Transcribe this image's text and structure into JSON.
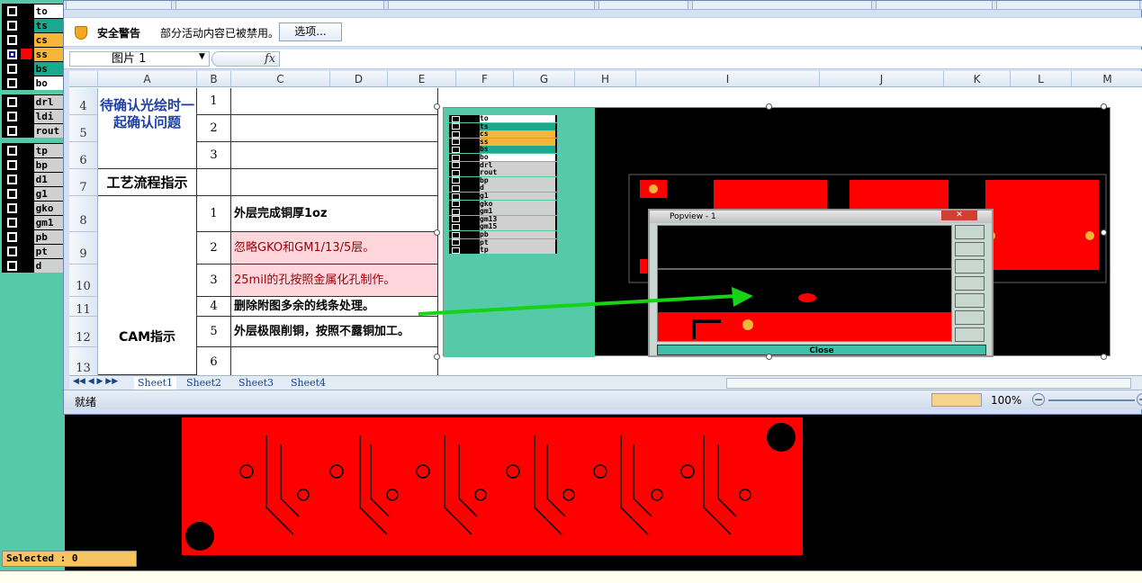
{
  "cam_layers_top": [
    {
      "name": "to",
      "color": "#ffffff",
      "swatch": "#000000"
    },
    {
      "name": "ts",
      "color": "#1ca88c",
      "swatch": "#000000"
    },
    {
      "name": "cs",
      "color": "#f5b63a",
      "swatch": "#000000"
    },
    {
      "name": "ss",
      "color": "#f5b63a",
      "swatch": "#ff0000",
      "selected": true
    },
    {
      "name": "bs",
      "color": "#1ca88c",
      "swatch": "#000000"
    },
    {
      "name": "bo",
      "color": "#ffffff",
      "swatch": "#000000"
    }
  ],
  "cam_layers_mid": [
    {
      "name": "drl",
      "color": "#d0d0d0"
    },
    {
      "name": "ldi",
      "color": "#d0d0d0"
    },
    {
      "name": "rout",
      "color": "#d0d0d0"
    }
  ],
  "cam_layers_bottom": [
    {
      "name": "tp",
      "color": "#d0d0d0"
    },
    {
      "name": "bp",
      "color": "#d0d0d0"
    },
    {
      "name": "d1",
      "color": "#d0d0d0"
    },
    {
      "name": "g1",
      "color": "#d0d0d0"
    },
    {
      "name": "gko",
      "color": "#d0d0d0"
    },
    {
      "name": "gm1",
      "color": "#d0d0d0"
    },
    {
      "name": "pb",
      "color": "#d0d0d0"
    },
    {
      "name": "pt",
      "color": "#d0d0d0"
    },
    {
      "name": "d",
      "color": "#d0d0d0"
    }
  ],
  "selected_label": "Selected : 0",
  "security": {
    "title": "安全警告",
    "message": "部分活动内容已被禁用。",
    "options_button": "选项..."
  },
  "name_box": "图片 1",
  "fx_label": "fx",
  "columns": [
    "A",
    "B",
    "C",
    "D",
    "E",
    "F",
    "G",
    "H",
    "I",
    "J",
    "K",
    "L",
    "M"
  ],
  "rows": [
    {
      "num": "4",
      "b": "1",
      "c": ""
    },
    {
      "num": "5",
      "b": "2",
      "c": ""
    },
    {
      "num": "6",
      "b": "3",
      "c": ""
    },
    {
      "num": "7",
      "b": "",
      "c": ""
    },
    {
      "num": "8",
      "b": "1",
      "c": "外层完成铜厚1oz"
    },
    {
      "num": "9",
      "b": "2",
      "c": "忽略GKO和GM1/13/5层。"
    },
    {
      "num": "10",
      "b": "3",
      "c": "25mil的孔按照金属化孔制作。"
    },
    {
      "num": "11",
      "b": "4",
      "c": "删除附图多余的线条处理。"
    },
    {
      "num": "12",
      "b": "5",
      "c": "外层极限削铜，按照不露铜加工。"
    },
    {
      "num": "13",
      "b": "6",
      "c": ""
    }
  ],
  "merged_a": {
    "confirm": "待确认光绘时一起确认问题",
    "process": "工艺流程指示",
    "cam": "CAM指示"
  },
  "sheets": [
    "Sheet1",
    "Sheet2",
    "Sheet3",
    "Sheet4"
  ],
  "status": {
    "ready": "就绪",
    "zoom": "100%"
  },
  "pic_layers": [
    {
      "name": "to",
      "color": "#ffffff"
    },
    {
      "name": "ts",
      "color": "#1ca88c"
    },
    {
      "name": "cs",
      "color": "#f5b63a"
    },
    {
      "name": "ss",
      "color": "#f5b63a"
    },
    {
      "name": "bs",
      "color": "#1ca88c"
    },
    {
      "name": "bo",
      "color": "#ffffff"
    },
    {
      "name": "drl",
      "color": "#d0d0d0"
    },
    {
      "name": "rout",
      "color": "#d0d0d0"
    },
    {
      "name": "bp",
      "color": "#d0d0d0"
    },
    {
      "name": "d",
      "color": "#d0d0d0"
    },
    {
      "name": "g1",
      "color": "#d0d0d0"
    },
    {
      "name": "gko",
      "color": "#d0d0d0"
    },
    {
      "name": "gm1",
      "color": "#d0d0d0"
    },
    {
      "name": "gm13",
      "color": "#d0d0d0"
    },
    {
      "name": "gm15",
      "color": "#d0d0d0"
    },
    {
      "name": "pb",
      "color": "#d0d0d0"
    },
    {
      "name": "pt",
      "color": "#d0d0d0"
    },
    {
      "name": "tp",
      "color": "#d0d0d0"
    }
  ],
  "popview": {
    "title": "Popview - 1",
    "close": "Close"
  }
}
